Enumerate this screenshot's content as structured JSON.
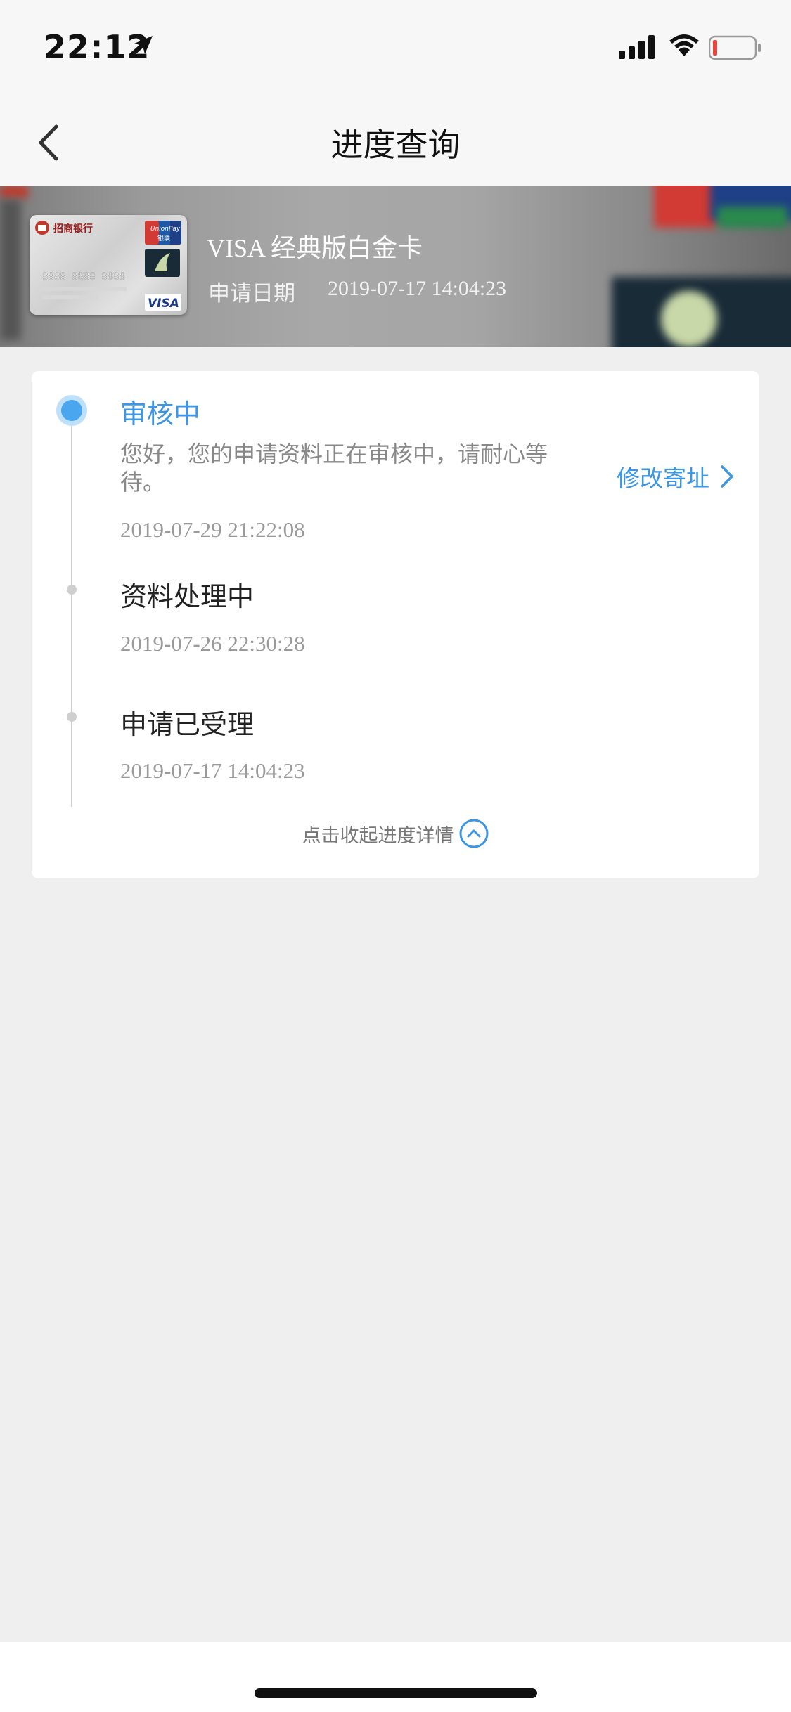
{
  "status_bar": {
    "time": "22:12"
  },
  "nav": {
    "title": "进度查询"
  },
  "card": {
    "name": "VISA 经典版白金卡",
    "apply_date_label": "申请日期",
    "apply_date": "2019-07-17 14:04:23",
    "thumb": {
      "bank_name": "招商银行",
      "network": "UnionPay",
      "network_cn": "银联",
      "number": "8888 8888 8888",
      "brand": "VISA"
    }
  },
  "progress": {
    "steps": [
      {
        "title": "审核中",
        "description": "您好，您的申请资料正在审核中，请耐心等待。",
        "time": "2019-07-29 21:22:08",
        "current": true
      },
      {
        "title": "资料处理中",
        "time": "2019-07-26 22:30:28",
        "current": false
      },
      {
        "title": "申请已受理",
        "time": "2019-07-17 14:04:23",
        "current": false
      }
    ],
    "modify_address": "修改寄址",
    "collapse": "点击收起进度详情"
  },
  "colors": {
    "accent": "#3b96e6",
    "page_bg": "#efefef"
  },
  "icons": [
    "location-arrow-icon",
    "signal-icon",
    "wifi-icon",
    "battery-icon",
    "back-chevron-icon",
    "chevron-right-icon",
    "chevron-up-circle-icon"
  ]
}
